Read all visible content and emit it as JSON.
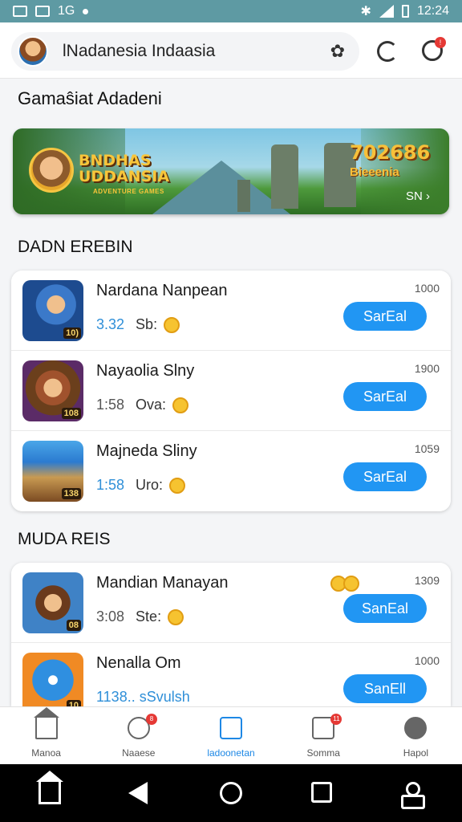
{
  "status_bar": {
    "left_text": "1G",
    "time": "12:24"
  },
  "header": {
    "title": "lNadanesia  Indaasia"
  },
  "section1": {
    "title": "Gamaŝiat Adadeni"
  },
  "banner": {
    "logo_text": "BNDHAS UDDANSIA",
    "logo_sub": "ADVENTURE GAMES",
    "year": "702686",
    "subtitle": "Bieeenia",
    "more": "SN ›"
  },
  "section2": {
    "title": "DADN EREBIN",
    "items": [
      {
        "name": "Nardana Nanpean",
        "num": "3.32",
        "label": "Sb:",
        "count": "1000",
        "button": "SarEal",
        "tag": "10)"
      },
      {
        "name": "Nayaolia Slny",
        "num": "1:58",
        "label": "Ova:",
        "count": "1900",
        "button": "SarEal",
        "tag": "108"
      },
      {
        "name": "Majneda Sliny",
        "num": "1:58",
        "label": "Uro:",
        "count": "1059",
        "button": "SarEal",
        "tag": "138"
      }
    ]
  },
  "section3": {
    "title": "MUDA REIS",
    "items": [
      {
        "name": "Mandian Manayan",
        "num": "3:08",
        "label": "Ste:",
        "count": "1309",
        "button": "SanEal",
        "tag": "08"
      },
      {
        "name": "Nenalla Om",
        "num": "1138.. sSvulsh",
        "label": "",
        "count": "1000",
        "button": "SanEll",
        "tag": "10"
      }
    ]
  },
  "bottom_nav": [
    {
      "label": "Manoa",
      "badge": ""
    },
    {
      "label": "Naaese",
      "badge": "8"
    },
    {
      "label": "ladoonetan",
      "badge": ""
    },
    {
      "label": "Somma",
      "badge": "11"
    },
    {
      "label": "Hapol",
      "badge": ""
    }
  ],
  "colors": {
    "status_bar": "#5e9aa3",
    "accent": "#2196f3",
    "active_nav": "#1e88e5"
  }
}
